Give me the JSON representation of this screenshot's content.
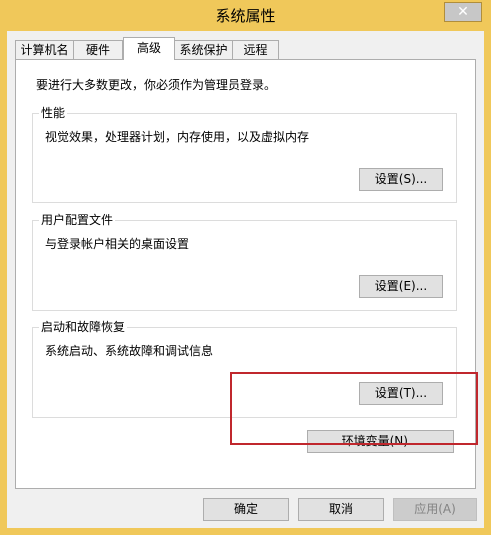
{
  "window": {
    "title": "系统属性",
    "close_symbol": "✕"
  },
  "tabs": [
    {
      "label": "计算机名",
      "active": false
    },
    {
      "label": "硬件",
      "active": false
    },
    {
      "label": "高级",
      "active": true
    },
    {
      "label": "系统保护",
      "active": false
    },
    {
      "label": "远程",
      "active": false
    }
  ],
  "advanced": {
    "admin_notice": "要进行大多数更改，你必须作为管理员登录。",
    "performance": {
      "title": "性能",
      "description": "视觉效果，处理器计划，内存使用，以及虚拟内存",
      "button": "设置(S)..."
    },
    "user_profiles": {
      "title": "用户配置文件",
      "description": "与登录帐户相关的桌面设置",
      "button": "设置(E)..."
    },
    "startup_recovery": {
      "title": "启动和故障恢复",
      "description": "系统启动、系统故障和调试信息",
      "button": "设置(T)..."
    },
    "env_button": "环境变量(N)..."
  },
  "footer": {
    "ok": "确定",
    "cancel": "取消",
    "apply": "应用(A)"
  },
  "colors": {
    "title_bar": "#f0c85a",
    "highlight_border": "#c0272d"
  }
}
